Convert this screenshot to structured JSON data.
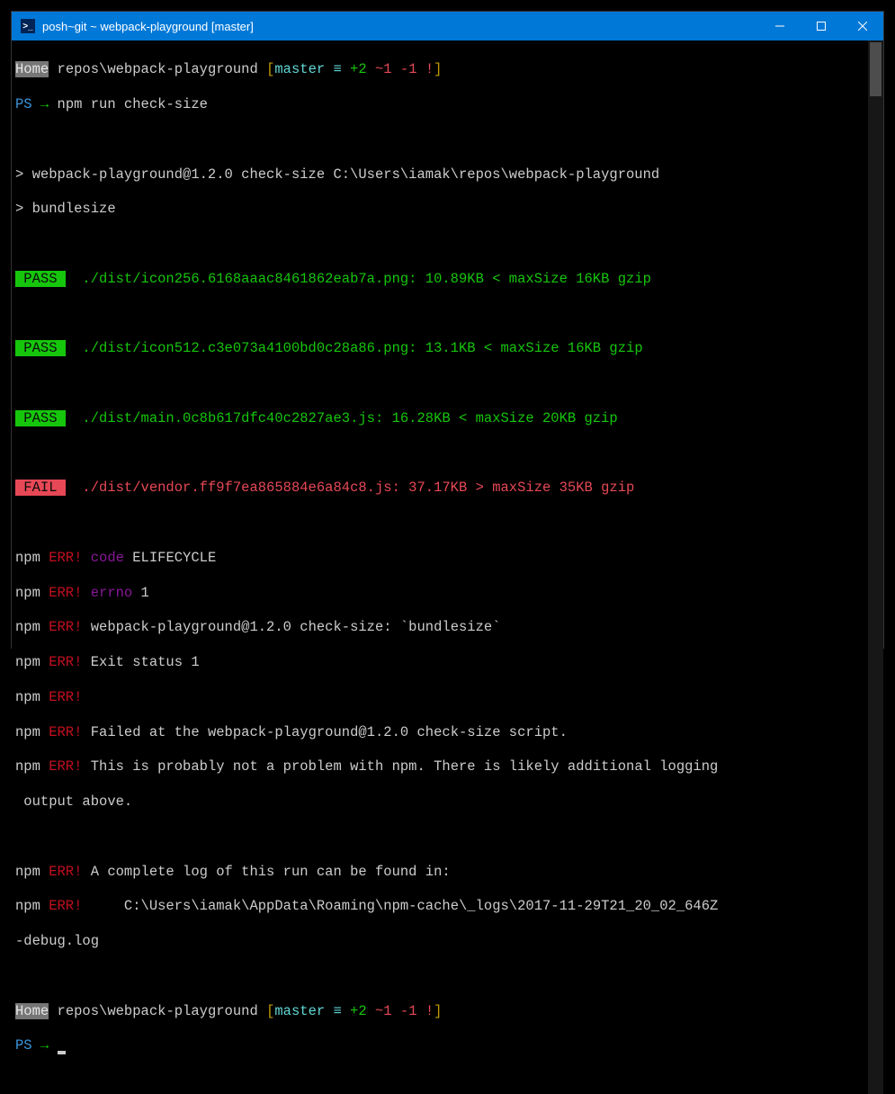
{
  "titlebar": {
    "title": "posh~git ~ webpack-playground [master]"
  },
  "prompt1": {
    "home": "Home",
    "path": " repos\\webpack-playground ",
    "lb": "[",
    "branch": "master",
    "eq": " ≡",
    "added": " +2",
    "mod": " ~1",
    "del": " -1",
    "excl": " !",
    "rb": "]"
  },
  "cmd1": {
    "ps": "PS",
    "arrow": " →",
    "text": " npm run check-size"
  },
  "script": {
    "l1": "> webpack-playground@1.2.0 check-size C:\\Users\\iamak\\repos\\webpack-playground",
    "l2": "> bundlesize"
  },
  "results": {
    "pass": " PASS ",
    "fail": " FAIL ",
    "r1": "  ./dist/icon256.6168aaac8461862eab7a.png: 10.89KB < maxSize 16KB gzip",
    "r2": "  ./dist/icon512.c3e073a4100bd0c28a86.png: 13.1KB < maxSize 16KB gzip",
    "r3": "  ./dist/main.0c8b617dfc40c2827ae3.js: 16.28KB < maxSize 20KB gzip",
    "r4": "  ./dist/vendor.ff9f7ea865884e6a84c8.js: 37.17KB > maxSize 35KB gzip"
  },
  "err": {
    "npm": "npm",
    "err": " ERR!",
    "code_k": " code",
    "code_v": " ELIFECYCLE",
    "errno_k": " errno",
    "errno_v": " 1",
    "l3": " webpack-playground@1.2.0 check-size: `bundlesize`",
    "l4": " Exit status 1",
    "l6": " Failed at the webpack-playground@1.2.0 check-size script.",
    "l7a": " This is probably not a problem with npm. There is likely additional logging",
    "l7b": " output above.",
    "l9": " A complete log of this run can be found in:",
    "l10a": "     C:\\Users\\iamak\\AppData\\Roaming\\npm-cache\\_logs\\2017-11-29T21_20_02_646Z",
    "l10b": "-debug.log"
  },
  "cmd2": {
    "ps": "PS",
    "arrow": " →",
    "text": " "
  }
}
